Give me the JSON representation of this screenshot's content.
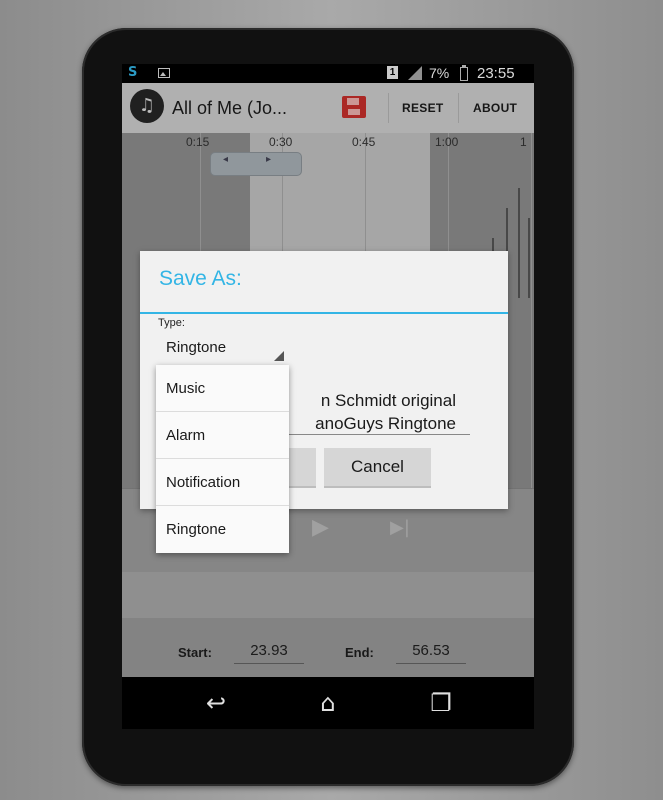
{
  "status_bar": {
    "sync_icon": "sync-icon",
    "image_icon": "image-notification-icon",
    "sim_label": "1",
    "battery_percent": "7%",
    "time": "23:55"
  },
  "app_bar": {
    "title": "All of Me (Jo...",
    "save_icon": "floppy-disk-icon",
    "reset_label": "RESET",
    "about_label": "ABOUT"
  },
  "waveform": {
    "time_labels": [
      "0:15",
      "0:30",
      "0:45",
      "1:00",
      "1"
    ]
  },
  "dialog": {
    "title": "Save As:",
    "type_label": "Type:",
    "type_value": "Ringtone",
    "name_value": "n Schmidt original\nanoGuys Ringtone",
    "cancel_label": "Cancel"
  },
  "dropdown": {
    "options": [
      "Music",
      "Alarm",
      "Notification",
      "Ringtone"
    ]
  },
  "range": {
    "start_label": "Start:",
    "start_value": "23.93",
    "end_label": "End:",
    "end_value": "56.53"
  },
  "nav_bar": {
    "back_icon": "back-icon",
    "home_icon": "home-icon",
    "recents_icon": "recent-apps-icon"
  },
  "colors": {
    "accent": "#33b5e5",
    "save_icon": "#c9302c"
  }
}
